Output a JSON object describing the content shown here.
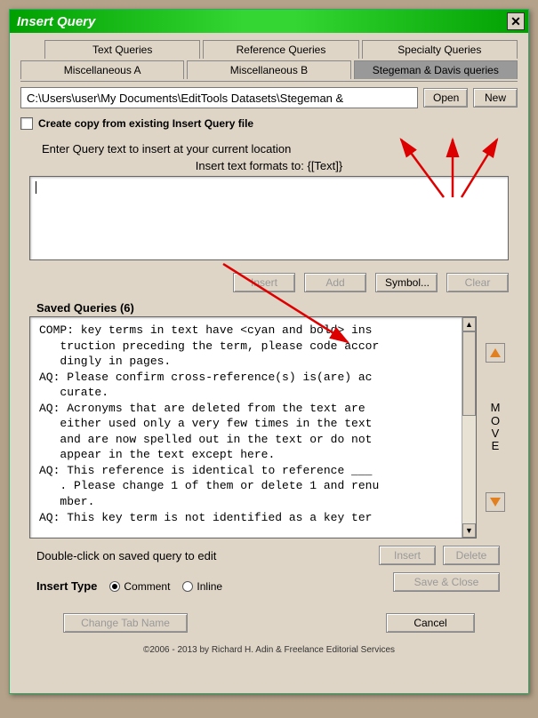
{
  "window": {
    "title": "Insert Query"
  },
  "tabs": {
    "row1": [
      {
        "label": "Text Queries"
      },
      {
        "label": "Reference Queries"
      },
      {
        "label": "Specialty Queries"
      }
    ],
    "row2": [
      {
        "label": "Miscellaneous A"
      },
      {
        "label": "Miscellaneous B"
      },
      {
        "label": "Stegeman & Davis queries",
        "active": true
      }
    ]
  },
  "path": {
    "value": "C:\\Users\\user\\My Documents\\EditTools Datasets\\Stegeman &",
    "open_label": "Open",
    "new_label": "New"
  },
  "create_copy": {
    "label": "Create copy from existing Insert Query file"
  },
  "enter_query": {
    "text": "Enter Query text to insert at your current location"
  },
  "format_hint": {
    "text": "Insert text formats to: {[Text]}"
  },
  "buttons": {
    "insert": "Insert",
    "add": "Add",
    "symbol": "Symbol...",
    "clear": "Clear",
    "delete": "Delete",
    "save_close": "Save & Close",
    "change_tab": "Change Tab Name",
    "cancel": "Cancel"
  },
  "saved": {
    "label": "Saved Queries (6)",
    "content": "COMP: key terms in text have <cyan and bold> ins\n   truction preceding the term, please code accor\n   dingly in pages.\nAQ: Please confirm cross-reference(s) is(are) ac\n   curate.\nAQ: Acronyms that are deleted from the text are \n   either used only a very few times in the text \n   and are now spelled out in the text or do not \n   appear in the text except here.\nAQ: This reference is identical to reference ___\n   . Please change 1 of them or delete 1 and renu\n   mber.\nAQ: This key term is not identified as a key ter"
  },
  "move": {
    "m": "M",
    "o": "O",
    "v": "V",
    "e": "E"
  },
  "hint": {
    "text": "Double-click on saved query to edit"
  },
  "insert_type": {
    "label": "Insert Type",
    "comment": "Comment",
    "inline": "Inline"
  },
  "copyright": {
    "text": "©2006 - 2013 by Richard H. Adin & Freelance Editorial Services"
  }
}
